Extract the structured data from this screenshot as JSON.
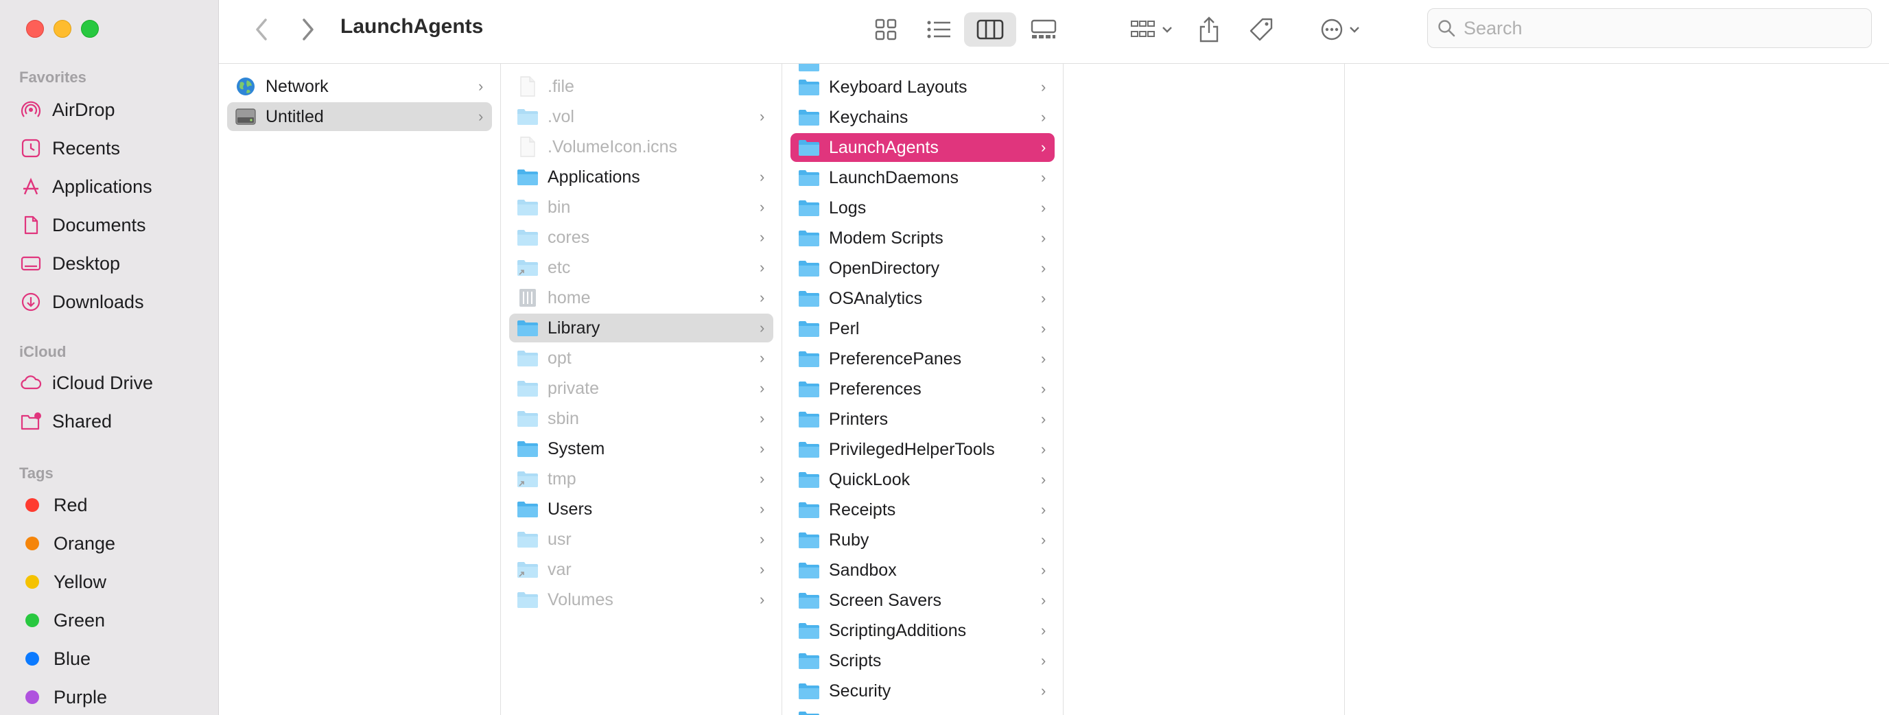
{
  "window": {
    "title": "LaunchAgents"
  },
  "toolbar": {
    "back": "back",
    "forward": "forward",
    "views": [
      "icon-view",
      "list-view",
      "column-view",
      "gallery-view"
    ],
    "selected_view": "column-view",
    "search_placeholder": "Search"
  },
  "sidebar": {
    "favorites_label": "Favorites",
    "favorites": [
      {
        "label": "AirDrop",
        "icon": "airdrop-icon"
      },
      {
        "label": "Recents",
        "icon": "clock-icon"
      },
      {
        "label": "Applications",
        "icon": "applications-icon"
      },
      {
        "label": "Documents",
        "icon": "document-icon"
      },
      {
        "label": "Desktop",
        "icon": "desktop-icon"
      },
      {
        "label": "Downloads",
        "icon": "download-icon"
      }
    ],
    "icloud_label": "iCloud",
    "icloud": [
      {
        "label": "iCloud Drive",
        "icon": "cloud-icon"
      },
      {
        "label": "Shared",
        "icon": "shared-folder-icon"
      }
    ],
    "tags_label": "Tags",
    "tags": [
      {
        "label": "Red",
        "color": "#fe3b30"
      },
      {
        "label": "Orange",
        "color": "#f5850a"
      },
      {
        "label": "Yellow",
        "color": "#f5c200"
      },
      {
        "label": "Green",
        "color": "#29c840"
      },
      {
        "label": "Blue",
        "color": "#0b7aff"
      },
      {
        "label": "Purple",
        "color": "#af52de"
      }
    ]
  },
  "columns": {
    "col1": [
      {
        "label": "Network",
        "icon": "globe-icon",
        "chevron": true,
        "state": "normal"
      },
      {
        "label": "Untitled",
        "icon": "disk-icon",
        "chevron": true,
        "state": "selected-inactive"
      }
    ],
    "col2": [
      {
        "label": ".file",
        "icon": "file-icon",
        "chevron": false,
        "state": "dim"
      },
      {
        "label": ".vol",
        "icon": "folder-icon",
        "chevron": true,
        "state": "dim"
      },
      {
        "label": ".VolumeIcon.icns",
        "icon": "file-icon",
        "chevron": false,
        "state": "dim"
      },
      {
        "label": "Applications",
        "icon": "folder-icon",
        "chevron": true,
        "state": "normal"
      },
      {
        "label": "bin",
        "icon": "folder-icon",
        "chevron": true,
        "state": "dim"
      },
      {
        "label": "cores",
        "icon": "folder-icon",
        "chevron": true,
        "state": "dim"
      },
      {
        "label": "etc",
        "icon": "alias-folder-icon",
        "chevron": true,
        "state": "dim"
      },
      {
        "label": "home",
        "icon": "server-icon",
        "chevron": true,
        "state": "dim"
      },
      {
        "label": "Library",
        "icon": "folder-icon",
        "chevron": true,
        "state": "selected-inactive"
      },
      {
        "label": "opt",
        "icon": "folder-icon",
        "chevron": true,
        "state": "dim"
      },
      {
        "label": "private",
        "icon": "folder-icon",
        "chevron": true,
        "state": "dim"
      },
      {
        "label": "sbin",
        "icon": "folder-icon",
        "chevron": true,
        "state": "dim"
      },
      {
        "label": "System",
        "icon": "folder-icon",
        "chevron": true,
        "state": "normal"
      },
      {
        "label": "tmp",
        "icon": "alias-folder-icon",
        "chevron": true,
        "state": "dim"
      },
      {
        "label": "Users",
        "icon": "folder-icon",
        "chevron": true,
        "state": "normal"
      },
      {
        "label": "usr",
        "icon": "folder-icon",
        "chevron": true,
        "state": "dim"
      },
      {
        "label": "var",
        "icon": "alias-folder-icon",
        "chevron": true,
        "state": "dim"
      },
      {
        "label": "Volumes",
        "icon": "folder-icon",
        "chevron": true,
        "state": "dim"
      }
    ],
    "col3": [
      {
        "label": "Keyboard Layouts",
        "icon": "folder-icon",
        "chevron": true,
        "state": "normal"
      },
      {
        "label": "Keychains",
        "icon": "folder-icon",
        "chevron": true,
        "state": "normal"
      },
      {
        "label": "LaunchAgents",
        "icon": "folder-icon",
        "chevron": true,
        "state": "selected-active"
      },
      {
        "label": "LaunchDaemons",
        "icon": "folder-icon",
        "chevron": true,
        "state": "normal"
      },
      {
        "label": "Logs",
        "icon": "folder-icon",
        "chevron": true,
        "state": "normal"
      },
      {
        "label": "Modem Scripts",
        "icon": "folder-icon",
        "chevron": true,
        "state": "normal"
      },
      {
        "label": "OpenDirectory",
        "icon": "folder-icon",
        "chevron": true,
        "state": "normal"
      },
      {
        "label": "OSAnalytics",
        "icon": "folder-icon",
        "chevron": true,
        "state": "normal"
      },
      {
        "label": "Perl",
        "icon": "folder-icon",
        "chevron": true,
        "state": "normal"
      },
      {
        "label": "PreferencePanes",
        "icon": "folder-icon",
        "chevron": true,
        "state": "normal"
      },
      {
        "label": "Preferences",
        "icon": "folder-icon",
        "chevron": true,
        "state": "normal"
      },
      {
        "label": "Printers",
        "icon": "folder-icon",
        "chevron": true,
        "state": "normal"
      },
      {
        "label": "PrivilegedHelperTools",
        "icon": "folder-icon",
        "chevron": true,
        "state": "normal"
      },
      {
        "label": "QuickLook",
        "icon": "folder-icon",
        "chevron": true,
        "state": "normal"
      },
      {
        "label": "Receipts",
        "icon": "folder-icon",
        "chevron": true,
        "state": "normal"
      },
      {
        "label": "Ruby",
        "icon": "folder-icon",
        "chevron": true,
        "state": "normal"
      },
      {
        "label": "Sandbox",
        "icon": "folder-icon",
        "chevron": true,
        "state": "normal"
      },
      {
        "label": "Screen Savers",
        "icon": "folder-icon",
        "chevron": true,
        "state": "normal"
      },
      {
        "label": "ScriptingAdditions",
        "icon": "folder-icon",
        "chevron": true,
        "state": "normal"
      },
      {
        "label": "Scripts",
        "icon": "folder-icon",
        "chevron": true,
        "state": "normal"
      },
      {
        "label": "Security",
        "icon": "folder-icon",
        "chevron": true,
        "state": "normal"
      }
    ]
  }
}
